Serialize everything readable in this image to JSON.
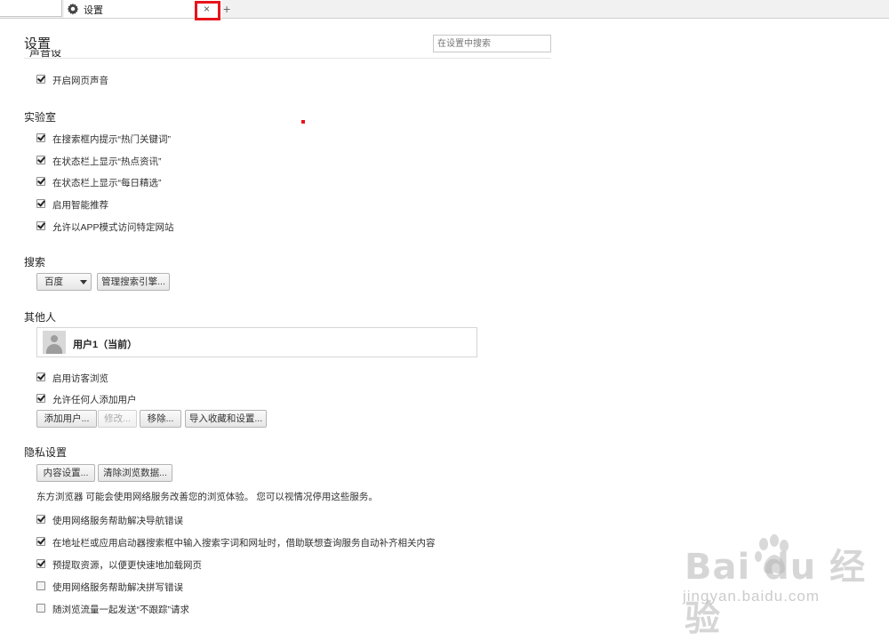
{
  "tabs": {
    "left_tab_label": "",
    "active_tab_title": "设置",
    "close_symbol": "×",
    "new_tab_symbol": "+"
  },
  "header": {
    "title": "设置",
    "search_placeholder": "在设置中搜索",
    "clipped_section_title": "声音设置"
  },
  "sound": {
    "items": [
      {
        "label": "开启网页声音",
        "checked": true
      }
    ]
  },
  "lab": {
    "title": "实验室",
    "items": [
      {
        "label": "在搜索框内提示“热门关键词”",
        "checked": true
      },
      {
        "label": "在状态栏上显示“热点资讯”",
        "checked": true
      },
      {
        "label": "在状态栏上显示“每日精选”",
        "checked": true
      },
      {
        "label": "启用智能推荐",
        "checked": true
      },
      {
        "label": "允许以APP模式访问特定网站",
        "checked": true
      }
    ]
  },
  "search_section": {
    "title": "搜索",
    "engine_selected": "百度",
    "manage_button": "管理搜索引擎..."
  },
  "people": {
    "title": "其他人",
    "profile_name": "用户1（当前）",
    "items": [
      {
        "label": "启用访客浏览",
        "checked": true
      },
      {
        "label": "允许任何人添加用户",
        "checked": true
      }
    ],
    "buttons": {
      "add": "添加用户...",
      "edit": "修改...",
      "remove": "移除...",
      "import": "导入收藏和设置..."
    }
  },
  "privacy": {
    "title": "隐私设置",
    "buttons": {
      "content": "内容设置...",
      "clear": "清除浏览数据..."
    },
    "note": "东方浏览器 可能会使用网络服务改善您的浏览体验。 您可以视情况停用这些服务。",
    "items": [
      {
        "label": "使用网络服务帮助解决导航错误",
        "checked": true
      },
      {
        "label": "在地址栏或应用启动器搜索框中输入搜索字词和网址时，借助联想查询服务自动补齐相关内容",
        "checked": true
      },
      {
        "label": "预提取资源，以便更快速地加载网页",
        "checked": true
      },
      {
        "label": "使用网络服务帮助解决拼写错误",
        "checked": false
      },
      {
        "label": "随浏览流量一起发送“不跟踪”请求",
        "checked": false
      }
    ]
  },
  "watermark": {
    "brand": "Bai du 经验",
    "url": "jingyan.baidu.com"
  },
  "colors": {
    "highlight": "#e8141b",
    "text": "#303030"
  }
}
